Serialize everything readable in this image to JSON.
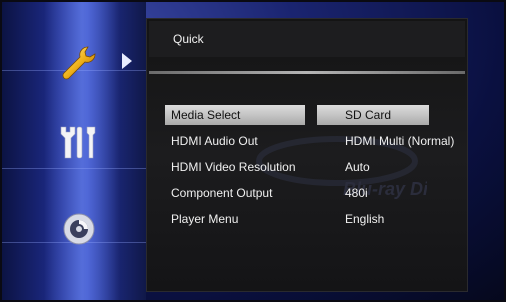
{
  "panel": {
    "title": "Quick"
  },
  "watermark": {
    "text": "Blu-ray Disc"
  },
  "sidebar": {
    "items": [
      {
        "icon": "wrench-icon",
        "selected": true
      },
      {
        "icon": "tools-icon",
        "selected": false
      },
      {
        "icon": "disc-icon",
        "selected": false
      }
    ]
  },
  "settings": [
    {
      "label": "Media Select",
      "value": "SD Card",
      "selected": true
    },
    {
      "label": "HDMI Audio Out",
      "value": "HDMI Multi (Normal)",
      "selected": false
    },
    {
      "label": "HDMI Video Resolution",
      "value": "Auto",
      "selected": false
    },
    {
      "label": "Component Output",
      "value": "480i",
      "selected": false
    },
    {
      "label": "Player Menu",
      "value": "English",
      "selected": false
    }
  ],
  "colors": {
    "highlight": "#c4c4c4",
    "text": "#f0f0f0",
    "sidebar_glow": "#2c3fb4"
  }
}
